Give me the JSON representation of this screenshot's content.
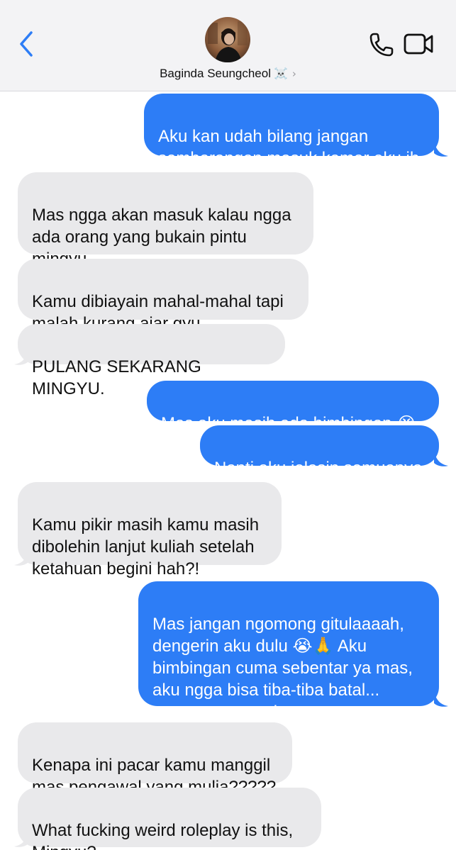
{
  "header": {
    "contact_name": "Baginda Seungcheol",
    "name_emoji": "☠️",
    "chevron": "›",
    "icons": {
      "back": "chevron-left-icon",
      "phone": "phone-icon",
      "video": "video-camera-icon"
    },
    "accent_color": "#2d7df6"
  },
  "messages": [
    {
      "side": "out",
      "text": "Aku kan udah bilang jangan\nsembarangan masuk kamar aku ih"
    },
    {
      "side": "in",
      "text": "Mas ngga akan masuk kalau ngga\nada orang yang bukain pintu\nmingyu"
    },
    {
      "side": "in",
      "text": "Kamu dibiayain mahal-mahal tapi\nmalah kurang ajar gyu"
    },
    {
      "side": "in",
      "text": "PULANG SEKARANG MINGYU."
    },
    {
      "side": "out",
      "text": "Mas aku masih ada bimbingan 😭"
    },
    {
      "side": "out",
      "text": "Nanti aku jelasin semuanya"
    },
    {
      "side": "in",
      "text": "Kamu pikir masih kamu masih\ndibolehin lanjut kuliah setelah\nketahuan begini hah?!"
    },
    {
      "side": "out",
      "text": "Mas jangan ngomong gitulaaaah,\ndengerin aku dulu 😭🙏 Aku\nbimbingan cuma sebentar ya mas,\naku ngga bisa tiba-tiba batal...\npercaya sama aku"
    },
    {
      "side": "in",
      "text": "Kenapa ini pacar kamu manggil\nmas pengawal yang mulia?????"
    },
    {
      "side": "in",
      "text": "What fucking weird roleplay is this,\nMingyu?"
    }
  ],
  "colors": {
    "outgoing_bubble": "#2d7df6",
    "incoming_bubble": "#e9e9eb",
    "header_bg": "#f3f3f5"
  }
}
